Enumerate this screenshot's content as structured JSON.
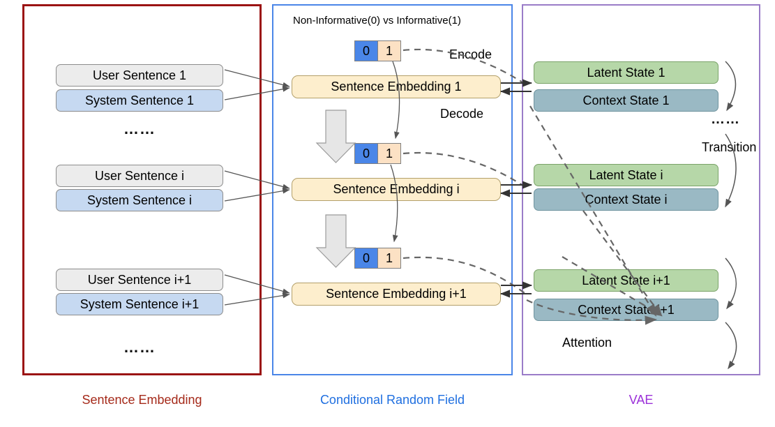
{
  "panels": [
    {
      "id": "sentence-embedding",
      "label": "Sentence Embedding",
      "color": "#a52a1a"
    },
    {
      "id": "conditional-random-field",
      "label": "Conditional Random Field",
      "color": "#1f6fe0"
    },
    {
      "id": "vae",
      "label": "VAE",
      "color": "#9b30d9"
    }
  ],
  "left": {
    "groups": [
      {
        "user": "User Sentence 1",
        "system": "System Sentence 1"
      },
      {
        "user": "User Sentence i",
        "system": "System Sentence i"
      },
      {
        "user": "User Sentence i+1",
        "system": "System Sentence i+1"
      }
    ],
    "ellipsis_top": "……",
    "ellipsis_bottom": "……"
  },
  "middle": {
    "legend": "Non-Informative(0) vs Informative(1)",
    "crf_tags": [
      {
        "zero": "0",
        "one": "1"
      },
      {
        "zero": "0",
        "one": "1"
      },
      {
        "zero": "0",
        "one": "1"
      }
    ],
    "embeddings": [
      "Sentence Embedding 1",
      "Sentence Embedding i",
      "Sentence Embedding i+1"
    ],
    "encode_label": "Encode",
    "decode_label": "Decode"
  },
  "right": {
    "rows": [
      {
        "latent": "Latent State  1",
        "context": "Context State  1"
      },
      {
        "latent": "Latent State  i",
        "context": "Context State  i"
      },
      {
        "latent": "Latent State  i+1",
        "context": "Context State  i+1"
      }
    ],
    "ellipsis": "……",
    "transition_label": "Transition",
    "attention_label": "Attention"
  },
  "colors": {
    "panel_red": "#9b1313",
    "panel_blue": "#4a86e8",
    "panel_purple": "#9a7cc8",
    "user_box": "#ececec",
    "system_box": "#c6d9f1",
    "embedding_box": "#fdeecd",
    "latent_box": "#b6d7a8",
    "context_box": "#9ab9c4",
    "crf_zero": "#4a86e8",
    "crf_one": "#fce1c4",
    "arrow": "#555555"
  }
}
